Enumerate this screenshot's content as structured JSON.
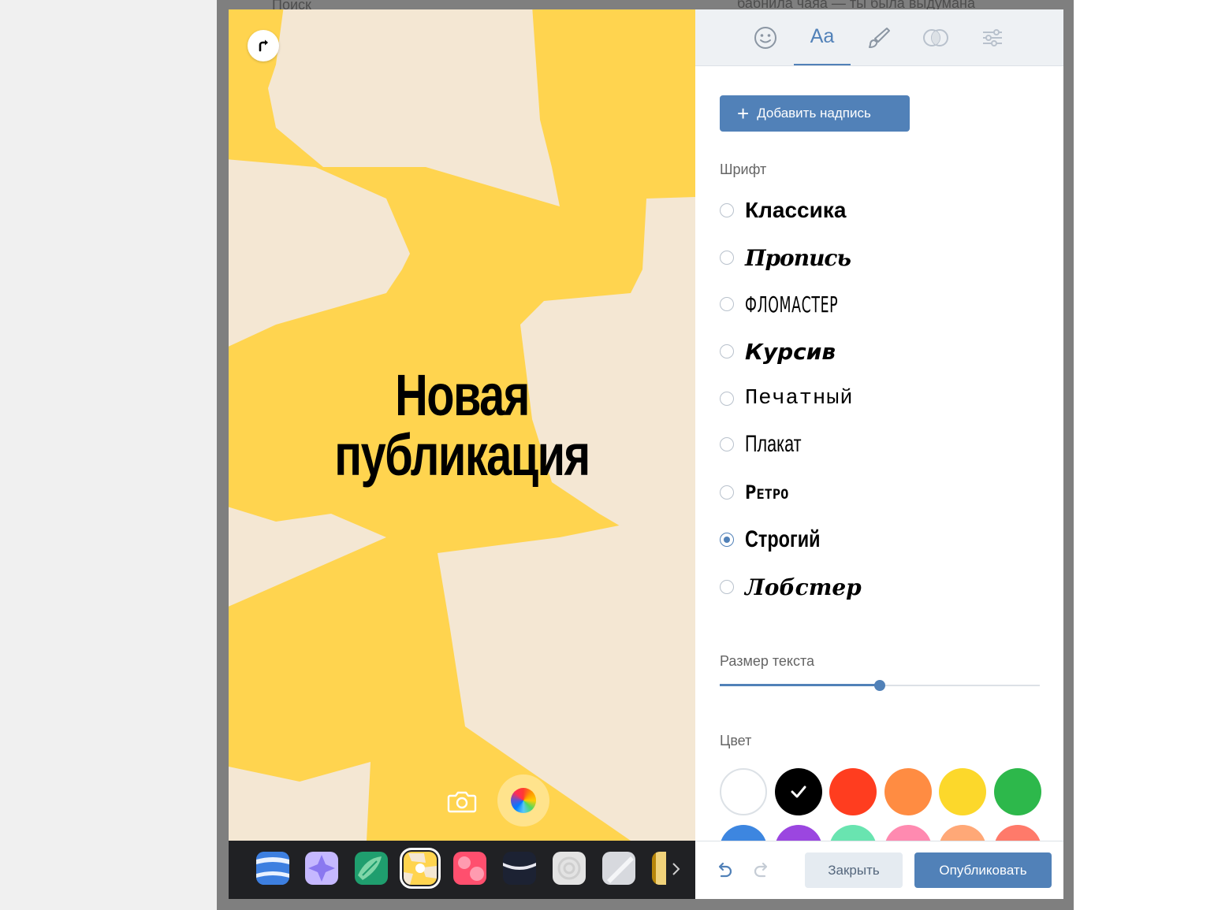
{
  "colors": {
    "accent": "#5181b8",
    "canvas_yellow": "#ffd44f",
    "canvas_cream": "#f4e7d3"
  },
  "backdrop": {
    "search_placeholder": "Поиск",
    "post_text": "бабнила чаяа — ты была выдумана"
  },
  "editor": {
    "rotate_icon": "rotate-icon",
    "story_text_line1": "Новая",
    "story_text_line2": "публикация",
    "camera_icon": "camera-icon",
    "color_wheel_icon": "color-wheel-icon"
  },
  "tabs": [
    {
      "icon": "emoji-icon"
    },
    {
      "icon": "text-icon",
      "label": "Aa",
      "active": true
    },
    {
      "icon": "brush-icon"
    },
    {
      "icon": "filters-icon"
    },
    {
      "icon": "adjust-icon"
    }
  ],
  "text_panel": {
    "add_caption_label": "Добавить надпись",
    "font_section_label": "Шрифт",
    "fonts": [
      {
        "name": "Классика",
        "selected": false
      },
      {
        "name": "Пропись",
        "selected": false
      },
      {
        "name": "Фломастер",
        "selected": false
      },
      {
        "name": "Курсив",
        "selected": false
      },
      {
        "name": "Печатный",
        "selected": false
      },
      {
        "name": "Плакат",
        "selected": false
      },
      {
        "name": "Ретро",
        "selected": false
      },
      {
        "name": "Строгий",
        "selected": true
      },
      {
        "name": "Лобстер",
        "selected": false
      }
    ],
    "size_label": "Размер текста",
    "size_value": 0.5,
    "color_label": "Цвет",
    "palette": [
      "#ffffff",
      "#000000",
      "#ff3d1f",
      "#ff8c42",
      "#fcd82b",
      "#2db84b",
      "#3d86e0",
      "#9b46e0",
      "#69e4b0",
      "#ff8ab0",
      "#ffa877",
      "#ff7a6a"
    ],
    "selected_color": "#000000"
  },
  "footer": {
    "close_label": "Закрыть",
    "publish_label": "Опубликовать"
  }
}
